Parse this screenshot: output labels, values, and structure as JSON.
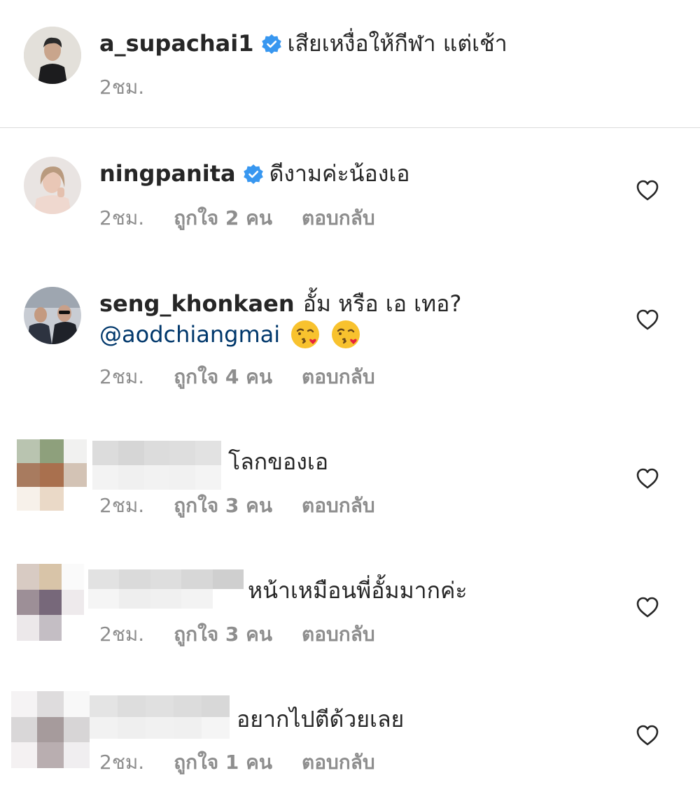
{
  "caption": {
    "username": "a_supachai1",
    "verified": true,
    "text": "เสียเหงื่อให้กีฬา แต่เช้า",
    "time": "2ชม."
  },
  "comments": [
    {
      "username": "ningpanita",
      "verified": true,
      "text": "ดีงามค่ะน้องเอ",
      "time": "2ชม.",
      "likes": "ถูกใจ 2 คน",
      "reply": "ตอบกลับ"
    },
    {
      "username": "seng_khonkaen",
      "verified": false,
      "text": "อั้ม หรือ เอ เทอ?",
      "mention": "@aodchiangmai",
      "emoji_icon": "face-blowing-kiss-icon",
      "time": "2ชม.",
      "likes": "ถูกใจ 4 คน",
      "reply": "ตอบกลับ"
    },
    {
      "username_blurred": true,
      "text": "โลกของเอ",
      "time": "2ชม.",
      "likes": "ถูกใจ 3 คน",
      "reply": "ตอบกลับ"
    },
    {
      "username_blurred": true,
      "text": "หน้าเหมือนพี่อั้มมากค่ะ",
      "time": "2ชม.",
      "likes": "ถูกใจ 3 คน",
      "reply": "ตอบกลับ"
    },
    {
      "username_blurred": true,
      "text": "อยากไปตีด้วยเลย",
      "time": "2ชม.",
      "likes": "ถูกใจ 1 คน",
      "reply": "ตอบกลับ"
    }
  ],
  "icons": {
    "verified": "verified-badge-icon",
    "heart": "heart-outline-icon"
  },
  "colors": {
    "verified_blue": "#3897f0",
    "mention_blue": "#00376b",
    "meta_gray": "#8e8e8e",
    "divider": "#dbdbdb"
  }
}
